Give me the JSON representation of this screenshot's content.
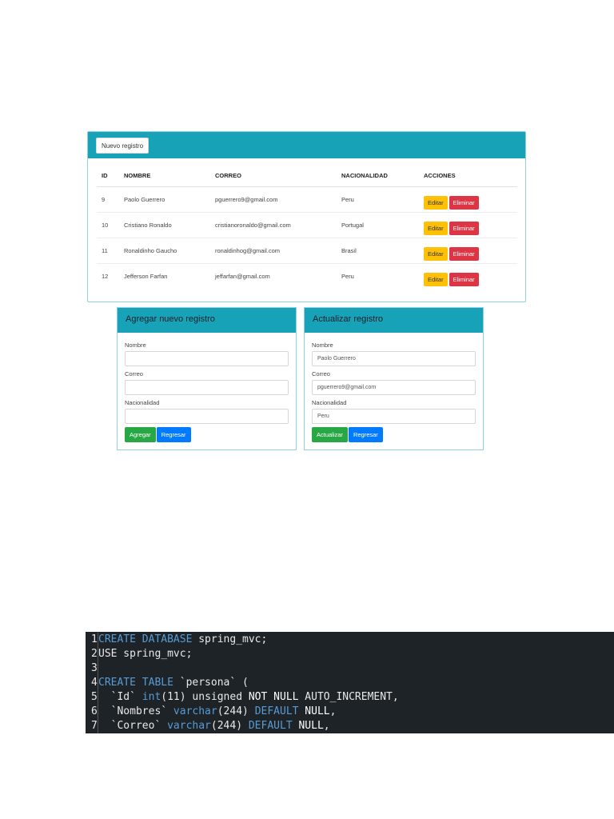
{
  "main_card": {
    "new_button": "Nuevo registro",
    "columns": [
      "ID",
      "NOMBRE",
      "CORREO",
      "NACIONALIDAD",
      "ACCIONES"
    ],
    "rows": [
      {
        "id": "9",
        "nombre": "Paolo Guerrero",
        "correo": "pguerrero9@gmail.com",
        "nacionalidad": "Peru"
      },
      {
        "id": "10",
        "nombre": "Cristiano Ronaldo",
        "correo": "cristianoronaldo@gmail.com",
        "nacionalidad": "Portugal"
      },
      {
        "id": "11",
        "nombre": "Ronaldinho Gaucho",
        "correo": "ronaldinhog@gmail.com",
        "nacionalidad": "Brasil"
      },
      {
        "id": "12",
        "nombre": "Jefferson Farfan",
        "correo": "jeffarfan@gmail.com",
        "nacionalidad": "Peru"
      }
    ],
    "edit_label": "Editar",
    "delete_label": "Eliminar"
  },
  "add_form": {
    "title": "Agregar nuevo registro",
    "nombre_label": "Nombre",
    "nombre_value": "",
    "correo_label": "Correo",
    "correo_value": "",
    "nacionalidad_label": "Nacionalidad",
    "nacionalidad_value": "",
    "submit_label": "Agregar",
    "back_label": "Regresar"
  },
  "update_form": {
    "title": "Actualizar registro",
    "nombre_label": "Nombre",
    "nombre_value": "Paolo Guerrero",
    "correo_label": "Correo",
    "correo_value": "pguerrero9@gmail.com",
    "nacionalidad_label": "Nacionalidad",
    "nacionalidad_value": "Peru",
    "submit_label": "Actualizar",
    "back_label": "Regresar"
  },
  "code": {
    "lines": [
      {
        "n": "1",
        "parts": [
          [
            "kw",
            "CREATE DATABASE"
          ],
          [
            "plain",
            " spring_mvc;"
          ]
        ]
      },
      {
        "n": "2",
        "parts": [
          [
            "plain",
            "USE spring_mvc;"
          ]
        ]
      },
      {
        "n": "3",
        "parts": []
      },
      {
        "n": "4",
        "parts": [
          [
            "kw",
            "CREATE TABLE"
          ],
          [
            "plain",
            " `persona` ("
          ]
        ]
      },
      {
        "n": "5",
        "parts": [
          [
            "plain",
            "  `Id` "
          ],
          [
            "kw",
            "int"
          ],
          [
            "plain",
            "(11) unsigned "
          ],
          [
            "bright",
            "NOT NULL"
          ],
          [
            "plain",
            " AUTO_INCREMENT,"
          ]
        ]
      },
      {
        "n": "6",
        "parts": [
          [
            "plain",
            "  `Nombres` "
          ],
          [
            "kw",
            "varchar"
          ],
          [
            "plain",
            "(244) "
          ],
          [
            "kw",
            "DEFAULT"
          ],
          [
            "bright",
            " NULL"
          ],
          [
            "plain",
            ","
          ]
        ]
      },
      {
        "n": "7",
        "parts": [
          [
            "plain",
            "  `Correo` "
          ],
          [
            "kw",
            "varchar"
          ],
          [
            "plain",
            "(244) "
          ],
          [
            "kw",
            "DEFAULT"
          ],
          [
            "bright",
            " NULL"
          ],
          [
            "plain",
            ","
          ]
        ]
      }
    ]
  }
}
